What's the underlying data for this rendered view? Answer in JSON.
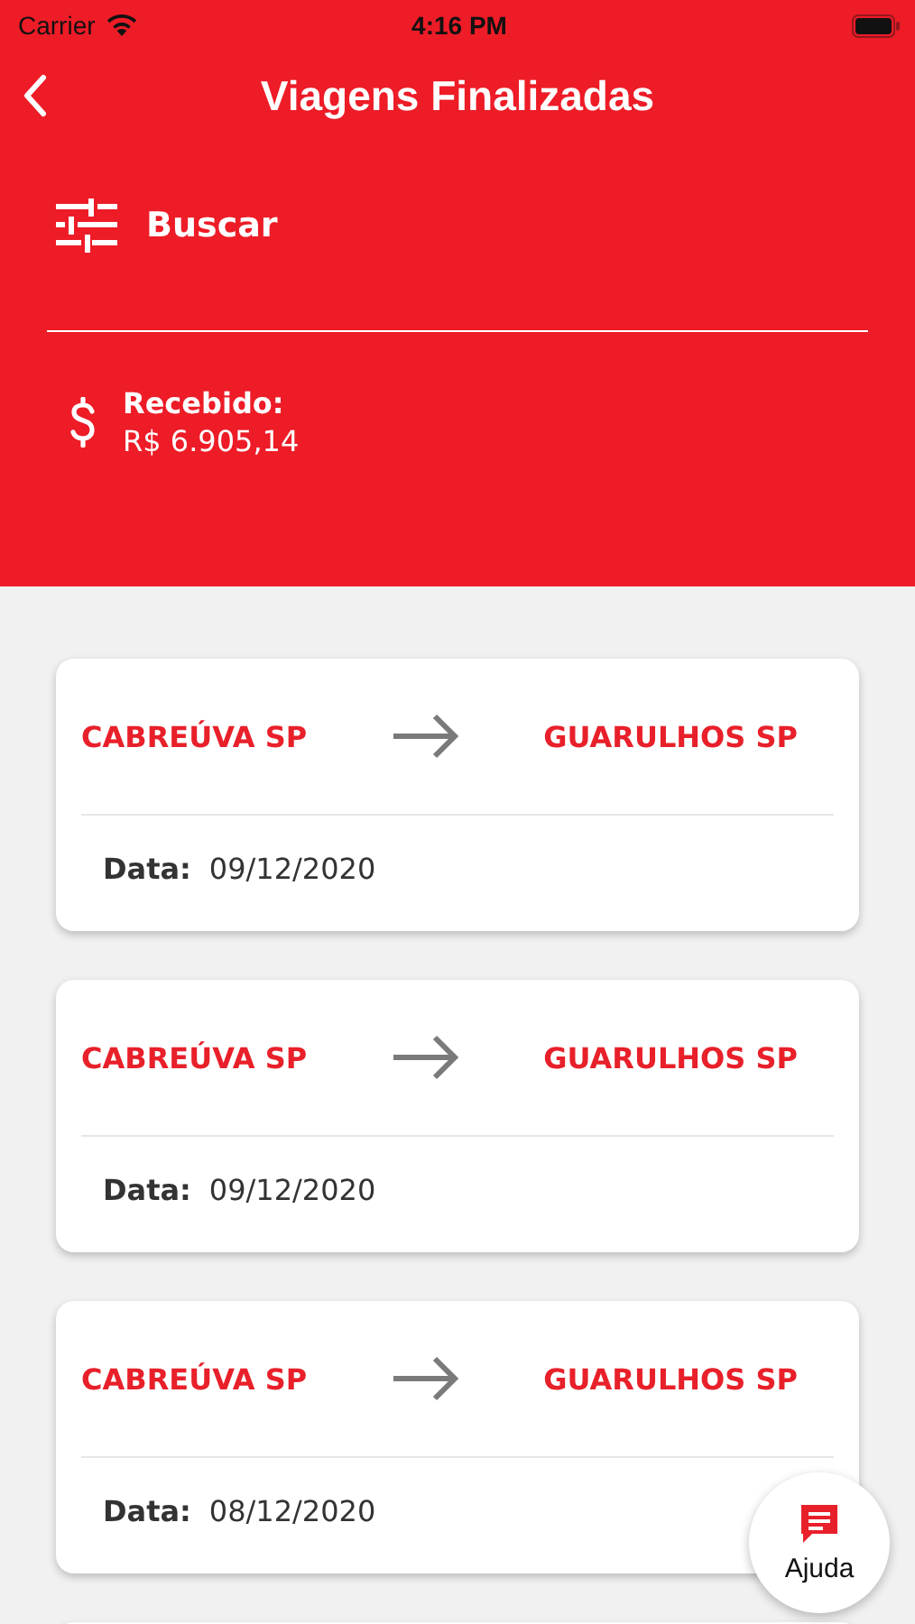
{
  "status_bar": {
    "carrier": "Carrier",
    "time": "4:16 PM"
  },
  "header": {
    "title": "Viagens Finalizadas"
  },
  "search": {
    "label": "Buscar"
  },
  "received": {
    "label": "Recebido:",
    "value": "R$ 6.905,14"
  },
  "trips": [
    {
      "origin": "CABREÚVA SP",
      "destination": "GUARULHOS SP",
      "date_label": "Data:",
      "date": "09/12/2020"
    },
    {
      "origin": "CABREÚVA SP",
      "destination": "GUARULHOS SP",
      "date_label": "Data:",
      "date": "09/12/2020"
    },
    {
      "origin": "CABREÚVA SP",
      "destination": "GUARULHOS SP",
      "date_label": "Data:",
      "date": "08/12/2020"
    }
  ],
  "help_button": {
    "label": "Ajuda"
  }
}
